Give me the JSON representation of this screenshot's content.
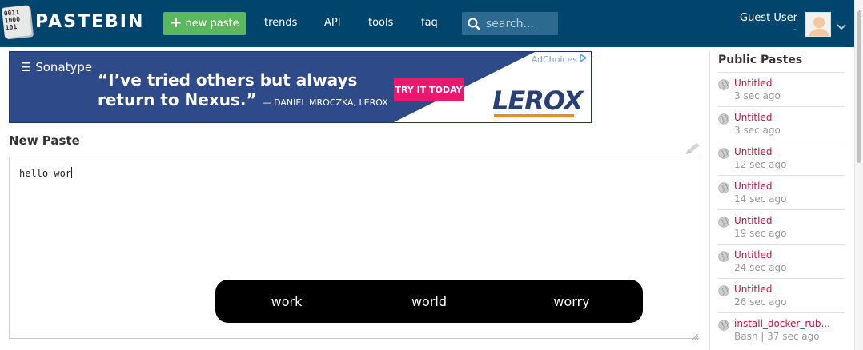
{
  "header": {
    "logo_bits": "0011\n1000\n101",
    "brand": "PASTEBIN",
    "new_paste_label": "new paste",
    "nav": [
      "trends",
      "API",
      "tools",
      "faq"
    ],
    "search_placeholder": "search...",
    "user_name": "Guest User",
    "user_sub": "-"
  },
  "ad": {
    "brand": "Sonatype",
    "quote": "“I’ve tried others but always return to Nexus.”",
    "attribution": "— DANIEL MROCZKA, LEROX",
    "cta": "TRY IT TODAY",
    "logo": "LEROX",
    "ad_choices": "AdChoices"
  },
  "editor": {
    "title": "New Paste",
    "content": "hello wor"
  },
  "suggestions": [
    "work",
    "world",
    "worry"
  ],
  "sidebar": {
    "title": "Public Pastes",
    "items": [
      {
        "title": "Untitled",
        "meta": "3 sec ago"
      },
      {
        "title": "Untitled",
        "meta": "3 sec ago"
      },
      {
        "title": "Untitled",
        "meta": "12 sec ago"
      },
      {
        "title": "Untitled",
        "meta": "14 sec ago"
      },
      {
        "title": "Untitled",
        "meta": "19 sec ago"
      },
      {
        "title": "Untitled",
        "meta": "24 sec ago"
      },
      {
        "title": "Untitled",
        "meta": "26 sec ago"
      },
      {
        "title": "install_docker_rub...",
        "meta": "Bash | 37 sec ago"
      }
    ]
  },
  "colors": {
    "header_bg": "#02456c",
    "new_paste_green": "#5cb85c",
    "link_red": "#c5143b",
    "ad_cta_pink": "#e8196e"
  }
}
